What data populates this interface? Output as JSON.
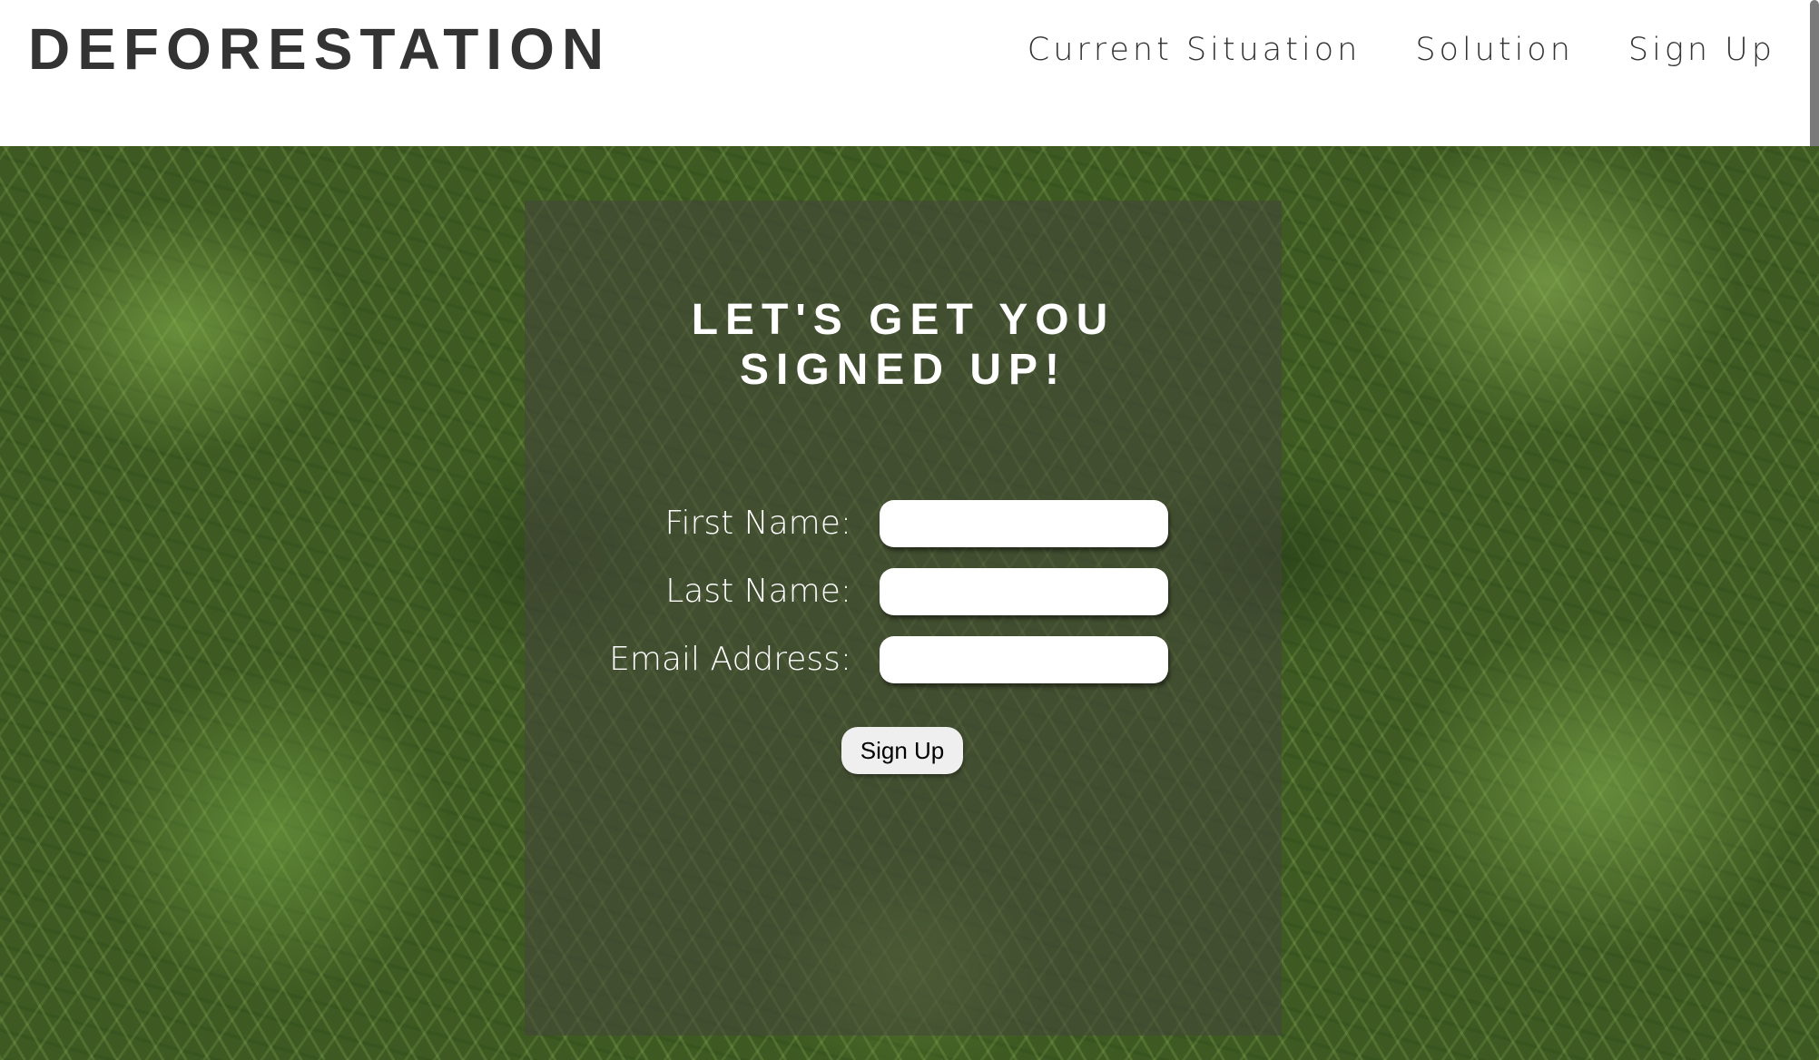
{
  "header": {
    "logo": "DEFORESTATION",
    "nav": [
      {
        "label": "Current Situation"
      },
      {
        "label": "Solution"
      },
      {
        "label": "Sign Up"
      }
    ]
  },
  "signup": {
    "title_line1": "LET'S GET YOU",
    "title_line2": "SIGNED UP!",
    "fields": [
      {
        "label": "First Name:",
        "value": ""
      },
      {
        "label": "Last Name:",
        "value": ""
      },
      {
        "label": "Email Address:",
        "value": ""
      }
    ],
    "button_label": "Sign Up"
  },
  "background": {
    "image": "moss-photo"
  }
}
